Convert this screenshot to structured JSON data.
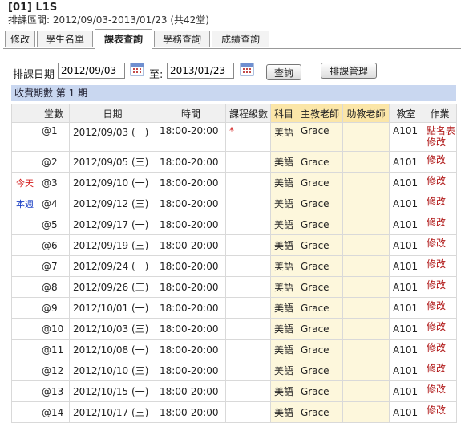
{
  "header": {
    "class_title": "[01] L1S",
    "class_range": "排課區間: 2012/09/03-2013/01/23 (共42堂)"
  },
  "tabs": [
    {
      "label": "修改",
      "active": false
    },
    {
      "label": "學生名單",
      "active": false
    },
    {
      "label": "課表查詢",
      "active": true
    },
    {
      "label": "學務查詢",
      "active": false
    },
    {
      "label": "成績查詢",
      "active": false
    }
  ],
  "toolbar": {
    "date_label": "排課日期",
    "start_date": "2012/09/03",
    "to_label": "至:",
    "end_date": "2013/01/23",
    "query_button": "查詢",
    "manage_button": "排課管理"
  },
  "period_bar": "收費期數 第 1 期",
  "columns": [
    "",
    "堂數",
    "日期",
    "時間",
    "課程級數",
    "科目",
    "主教老師",
    "助教老師",
    "教室",
    "作業"
  ],
  "rows": [
    {
      "marker": "",
      "lesson": "@1",
      "date": "2012/09/03 (一)",
      "time": "18:00-20:00",
      "level": "*",
      "subject": "美語",
      "teacher": "Grace",
      "assistant": "",
      "room": "A101",
      "actions": [
        "點名表",
        "修改"
      ]
    },
    {
      "marker": "",
      "lesson": "@2",
      "date": "2012/09/05 (三)",
      "time": "18:00-20:00",
      "level": "",
      "subject": "美語",
      "teacher": "Grace",
      "assistant": "",
      "room": "A101",
      "actions": [
        "修改"
      ]
    },
    {
      "marker": "今天",
      "lesson": "@3",
      "date": "2012/09/10 (一)",
      "time": "18:00-20:00",
      "level": "",
      "subject": "美語",
      "teacher": "Grace",
      "assistant": "",
      "room": "A101",
      "actions": [
        "修改"
      ]
    },
    {
      "marker": "本週",
      "lesson": "@4",
      "date": "2012/09/12 (三)",
      "time": "18:00-20:00",
      "level": "",
      "subject": "美語",
      "teacher": "Grace",
      "assistant": "",
      "room": "A101",
      "actions": [
        "修改"
      ]
    },
    {
      "marker": "",
      "lesson": "@5",
      "date": "2012/09/17 (一)",
      "time": "18:00-20:00",
      "level": "",
      "subject": "美語",
      "teacher": "Grace",
      "assistant": "",
      "room": "A101",
      "actions": [
        "修改"
      ]
    },
    {
      "marker": "",
      "lesson": "@6",
      "date": "2012/09/19 (三)",
      "time": "18:00-20:00",
      "level": "",
      "subject": "美語",
      "teacher": "Grace",
      "assistant": "",
      "room": "A101",
      "actions": [
        "修改"
      ]
    },
    {
      "marker": "",
      "lesson": "@7",
      "date": "2012/09/24 (一)",
      "time": "18:00-20:00",
      "level": "",
      "subject": "美語",
      "teacher": "Grace",
      "assistant": "",
      "room": "A101",
      "actions": [
        "修改"
      ]
    },
    {
      "marker": "",
      "lesson": "@8",
      "date": "2012/09/26 (三)",
      "time": "18:00-20:00",
      "level": "",
      "subject": "美語",
      "teacher": "Grace",
      "assistant": "",
      "room": "A101",
      "actions": [
        "修改"
      ]
    },
    {
      "marker": "",
      "lesson": "@9",
      "date": "2012/10/01 (一)",
      "time": "18:00-20:00",
      "level": "",
      "subject": "美語",
      "teacher": "Grace",
      "assistant": "",
      "room": "A101",
      "actions": [
        "修改"
      ]
    },
    {
      "marker": "",
      "lesson": "@10",
      "date": "2012/10/03 (三)",
      "time": "18:00-20:00",
      "level": "",
      "subject": "美語",
      "teacher": "Grace",
      "assistant": "",
      "room": "A101",
      "actions": [
        "修改"
      ]
    },
    {
      "marker": "",
      "lesson": "@11",
      "date": "2012/10/08 (一)",
      "time": "18:00-20:00",
      "level": "",
      "subject": "美語",
      "teacher": "Grace",
      "assistant": "",
      "room": "A101",
      "actions": [
        "修改"
      ]
    },
    {
      "marker": "",
      "lesson": "@12",
      "date": "2012/10/10 (三)",
      "time": "18:00-20:00",
      "level": "",
      "subject": "美語",
      "teacher": "Grace",
      "assistant": "",
      "room": "A101",
      "actions": [
        "修改"
      ]
    },
    {
      "marker": "",
      "lesson": "@13",
      "date": "2012/10/15 (一)",
      "time": "18:00-20:00",
      "level": "",
      "subject": "美語",
      "teacher": "Grace",
      "assistant": "",
      "room": "A101",
      "actions": [
        "修改"
      ]
    },
    {
      "marker": "",
      "lesson": "@14",
      "date": "2012/10/17 (三)",
      "time": "18:00-20:00",
      "level": "",
      "subject": "美語",
      "teacher": "Grace",
      "assistant": "",
      "room": "A101",
      "actions": [
        "修改"
      ]
    }
  ],
  "colors": {
    "period_bar": "#c9d7f0",
    "highlight_header": "#fbe6a8",
    "action_link": "#b01717",
    "today_marker": "#d41f1f",
    "week_marker": "#1a3fc4"
  },
  "icons": [
    "calendar-icon",
    "calendar-icon"
  ]
}
